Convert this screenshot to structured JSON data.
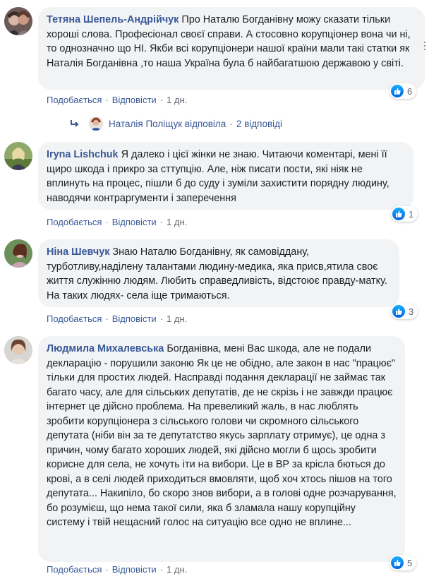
{
  "comments": [
    {
      "author": "Тетяна Шепель-Андрійчук",
      "text": "Про Наталю Богданівну можу сказати тільки хороші слова. Професіонал своєї справи. А стосовно корупціонер вона чи ні, то однозначно що НІ. Якби всі корупціонери нашої країни мали такі статки як Наталія Богданівна ,то наша Україна була б найбагатшою державою у світі.",
      "like": "Подобається",
      "reply": "Відповісти",
      "time": "1 дн.",
      "reactions": "6"
    },
    {
      "author": "Iryna Lishchuk",
      "text": "Я далеко і цієї жінки не знаю. Читаючи коментарі, мені її щиро шкода і прикро за сттупцію. Але, ніж писати пости, які ніяк не вплинуть на процес, пішли б до суду і зуміли захистити порядну людину, наводячи контраргументи і заперечення",
      "like": "Подобається",
      "reply": "Відповісти",
      "time": "1 дн.",
      "reactions": "1"
    },
    {
      "author": "Ніна Шевчук",
      "text": "Знаю Наталю Богданівну, як самовіддану, турботливу,наділену талантами людину-медика, яка присв,ятила своє життя служінню людям. Любить справедливість, відстоює правду-матку. На таких людях- села іще тримаються.",
      "like": "Подобається",
      "reply": "Відповісти",
      "time": "1 дн.",
      "reactions": "3"
    },
    {
      "author": "Людмила Михалевська",
      "text": "Богданівна, мені Вас шкода, але не подали декларацію - порушили законю Як це не обідно, але закон в нас \"працює\" тільки для простих людей. Насправді подання декларації не займає так багато часу, але для сільських депутатів, де не скрізь і не завжди працює інтернет це дійсно проблема. На превеликий жаль, в нас люблять зробити корупціонера з сільського голови чи скромного сільського депутата (ніби він за те депутатство якусь зарплату отримує), це одна з причин, чому багато хороших людей, які дійсно могли б щось зробити корисне для села, не хочуть іти на вибори. Це в ВР за крісла бються до крові, а в селі людей приходиться вмовляти, щоб хоч хтось пішов на того депутата... Накипіло, бо скоро знов вибори, а в голові одне розчарування, бо розумієш, що нема такої сили, яка б зламала нашу корупційну систему і твій нещасний голос на ситуацію все одно не вплине...",
      "like": "Подобається",
      "reply": "Відповісти",
      "time": "1 дн.",
      "reactions": "5"
    }
  ],
  "reply_thread": {
    "replier": "Наталія Поліщук відповіла",
    "count": "2 відповіді"
  },
  "separator": "·",
  "colors": {
    "link": "#385898",
    "bubble": "#f2f3f5",
    "meta": "#606770",
    "like_blue": "#1877f2"
  }
}
